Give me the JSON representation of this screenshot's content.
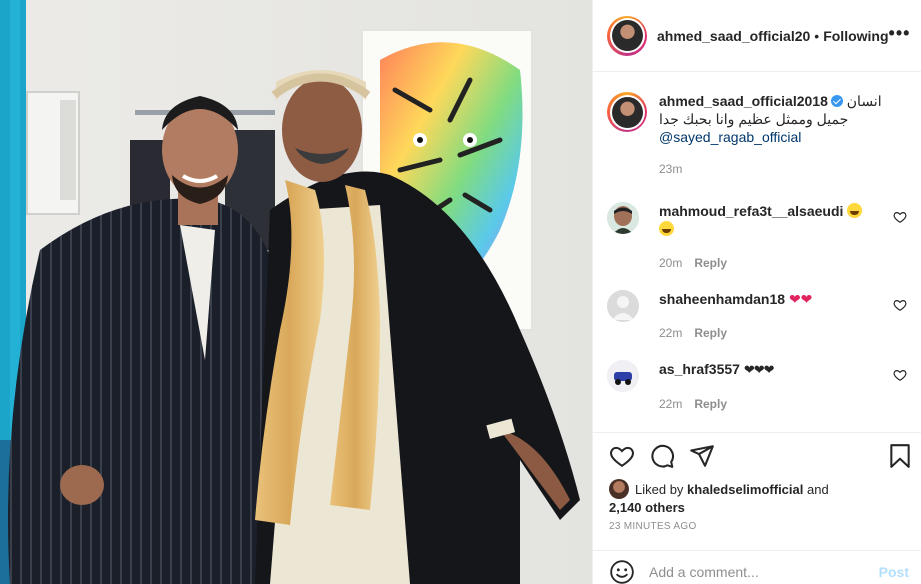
{
  "post": {
    "author": "ahmed_saad_official20",
    "separator": "•",
    "follow_status": "Following",
    "more_label": "•••",
    "photo_alt": "Two men in traditional Egyptian galabiyas"
  },
  "caption": {
    "author": "ahmed_saad_official2018",
    "text_line1": "انسان",
    "text_line2": "جميل وممثل عظيم وانا بحبك جدا",
    "mention": "@sayed_ragab_official",
    "time": "23m"
  },
  "comments": [
    {
      "user": "mahmoud_refa3t__alsaeudi",
      "time": "20m",
      "reply": "Reply"
    },
    {
      "user": "shaheenhamdan18",
      "time": "22m",
      "reply": "Reply"
    },
    {
      "user": "as_hraf3557",
      "time": "22m",
      "reply": "Reply"
    }
  ],
  "likes": {
    "prefix": "Liked by",
    "user": "khaledselimofficial",
    "and": "and",
    "others": "2,140 others"
  },
  "posted_ago": "23 MINUTES AGO",
  "add_comment": {
    "placeholder": "Add a comment...",
    "post_label": "Post"
  },
  "colors": {
    "accent_blue": "#3897f0",
    "post_disabled": "#b2dffc",
    "meta_gray": "#8e8e8e",
    "text": "#262626"
  },
  "icons": [
    "more-icon",
    "verified-icon",
    "heart-icon",
    "comment-icon",
    "share-icon",
    "bookmark-icon",
    "emoji-icon"
  ]
}
